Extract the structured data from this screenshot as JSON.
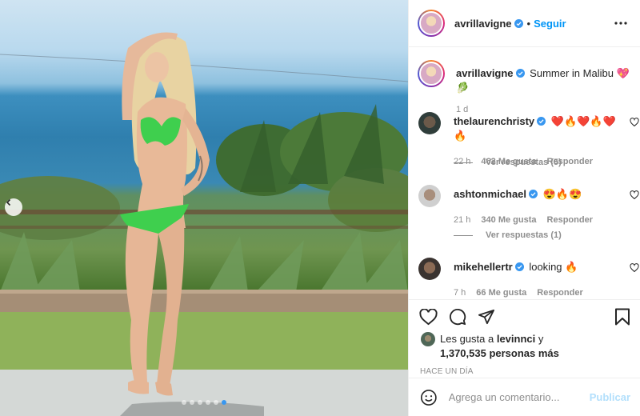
{
  "post": {
    "author": "avrillavigne",
    "author_verified": true,
    "follow_separator": "•",
    "follow_label": "Seguir",
    "more_icon": "more-icon",
    "carousel": {
      "dots": 6,
      "active_index": 5
    }
  },
  "caption": {
    "username": "avrillavigne",
    "text": "Summer in Malibu 💖🥬",
    "time": "1 d"
  },
  "comments": [
    {
      "username": "thelaurenchristy",
      "verified": true,
      "text": "❤️🔥❤️🔥❤️🔥",
      "time": "22 h",
      "likes": "462 Me gusta",
      "reply_label": "Responder",
      "replies": "Ver respuestas (5)"
    },
    {
      "username": "ashtonmichael",
      "verified": true,
      "text": "😍🔥😍",
      "time": "21 h",
      "likes": "340 Me gusta",
      "reply_label": "Responder",
      "replies": "Ver respuestas (1)"
    },
    {
      "username": "mikehellertr",
      "verified": true,
      "text": "looking 🔥",
      "time": "7 h",
      "likes": "66 Me gusta",
      "reply_label": "Responder"
    }
  ],
  "likes": {
    "prefix": "Les gusta a",
    "user": "levinnci",
    "connector": "y",
    "count": "1,370,535 personas más"
  },
  "post_date": "HACE UN DÍA",
  "comment_box": {
    "placeholder": "Agrega un comentario...",
    "post_label": "Publicar"
  },
  "colors": {
    "accent": "#0095f6",
    "verified": "#3897f0",
    "muted": "#8e8e8e",
    "post_disabled": "#b2dffc"
  }
}
